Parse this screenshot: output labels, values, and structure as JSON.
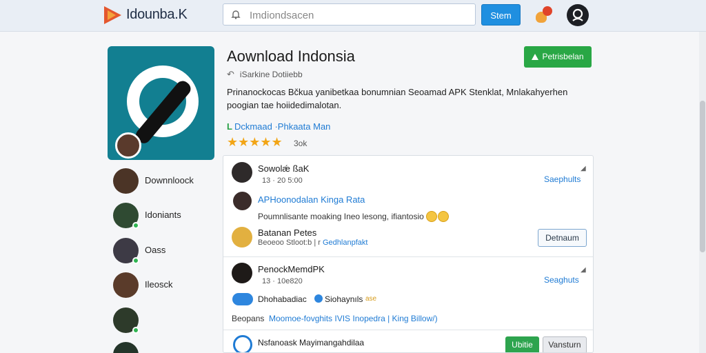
{
  "header": {
    "brand": "Idounba.K",
    "search_placeholder": "Imdiondsacen",
    "start_label": "Stem"
  },
  "app": {
    "title": "Aownload Indonsia",
    "publish_label": "Petrisbelan",
    "back_label": "iSarkine Dotiiebb",
    "description": "Prinanockocas Bčkua yanibetkaa bonumnian Seoamad APK Stenklat, Mnlakahyerhen poogian tae hoiidedimalotan.",
    "download_link_prefix": "L",
    "download_link": "Dckmaad ·Phkaata Man",
    "rating_stars": "★★★★★",
    "rating_count": "3ok"
  },
  "sidebar": {
    "items": [
      {
        "label": "Downnloock"
      },
      {
        "label": "Idoniants"
      },
      {
        "label": "Oass"
      },
      {
        "label": "Ileosck"
      },
      {
        "label": ""
      },
      {
        "label": ""
      }
    ]
  },
  "feed": {
    "posts": [
      {
        "name": "Sowolǽ ßaK",
        "time": "13 · 20 5:00",
        "action": "Saephults"
      },
      {
        "link": "APHoonodalan Kinga Rata",
        "text": "Poumnlisante moaking Ineo lesong, ifiantosio"
      },
      {
        "name": "Batanan Petes",
        "meta": "Beoeoo Stloot:b | r",
        "meta_link": "Gedhlanpfakt",
        "button": "Detnaum"
      },
      {
        "name": "PenockMemdPK",
        "time": "13 · 10e820",
        "action": "Seaghuts"
      },
      {
        "chat_text": "Dhohabadiac",
        "verified_text": "Siohaynıls",
        "tag": "ase"
      },
      {
        "prefix": "Beopans",
        "link": "Moomoe-fovghits IVIS Inopedra | King Billow/)"
      },
      {
        "name": "Nsfanoask Mayimangahdilaa",
        "green_button": "Ubitie",
        "gray_button": "Vansturn"
      }
    ]
  },
  "colors": {
    "accent": "#1f8fe0",
    "publish": "#29a745",
    "app_icon": "#127f91",
    "link": "#1f7bd4",
    "stars": "#f2a516"
  }
}
